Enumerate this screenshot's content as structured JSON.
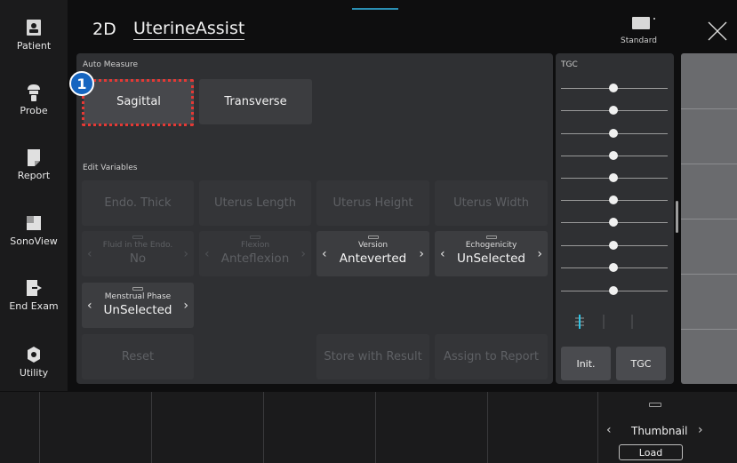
{
  "sidebar": {
    "items": [
      {
        "label": "Patient",
        "icon": "patient-icon"
      },
      {
        "label": "Probe",
        "icon": "probe-icon"
      },
      {
        "label": "Report",
        "icon": "report-icon"
      },
      {
        "label": "SonoView",
        "icon": "sonoview-icon"
      },
      {
        "label": "End Exam",
        "icon": "end-exam-icon"
      },
      {
        "label": "Utility",
        "icon": "utility-icon"
      }
    ]
  },
  "header": {
    "mode": "2D",
    "app_title": "UterineAssist",
    "preset_label": "Standard",
    "close_icon": "close-icon"
  },
  "auto_measure": {
    "title": "Auto Measure",
    "sagittal_label": "Sagittal",
    "transverse_label": "Transverse",
    "badge_number": "1"
  },
  "edit_variables": {
    "title": "Edit Variables",
    "endo_thick": "Endo. Thick",
    "uterus_length": "Uterus Length",
    "uterus_height": "Uterus Height",
    "uterus_width": "Uterus Width",
    "fluid": {
      "caption": "Fluid in the Endo.",
      "value": "No"
    },
    "flexion": {
      "caption": "Flexion",
      "value": "Anteflexion"
    },
    "version": {
      "caption": "Version",
      "value": "Anteverted"
    },
    "echogenicity": {
      "caption": "Echogenicity",
      "value": "UnSelected"
    },
    "menstrual": {
      "caption": "Menstrual Phase",
      "value": "UnSelected"
    },
    "reset_label": "Reset",
    "store_label": "Store with Result",
    "assign_label": "Assign to Report"
  },
  "tgc": {
    "title": "TGC",
    "init_label": "Init.",
    "tgc_label": "TGC"
  },
  "bottom": {
    "thumbnail_label": "Thumbnail",
    "load_label": "Load"
  },
  "colors": {
    "accent": "#2a8fb3",
    "highlight": "#e53935",
    "badge": "#1565c0"
  }
}
